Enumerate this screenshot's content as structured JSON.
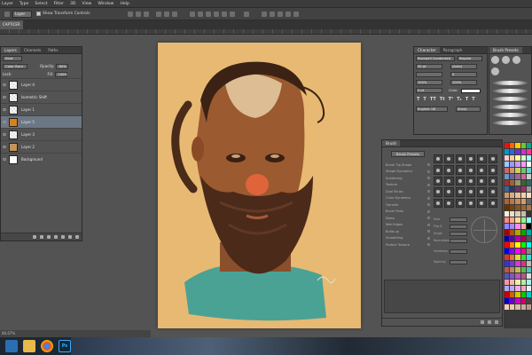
{
  "menubar": {
    "items": [
      "Layer",
      "Type",
      "Select",
      "Filter",
      "3D",
      "View",
      "Window",
      "Help"
    ]
  },
  "options": {
    "tool_preset": "Layer",
    "show_transform_label": "Show Transform Controls"
  },
  "document": {
    "tab_title": "CAPTICER"
  },
  "layers_panel": {
    "tabs": [
      "Layers",
      "Channels",
      "Paths"
    ],
    "kind_filter": "Kind",
    "blend_mode": "Color Burn",
    "opacity_label": "Opacity:",
    "opacity_value": "80%",
    "lock_label": "Lock:",
    "fill_label": "Fill:",
    "fill_value": "100%",
    "layers": [
      {
        "name": "Layer 4",
        "selected": false,
        "thumb": "transparent"
      },
      {
        "name": "Isometric Shift",
        "selected": false,
        "thumb": "transparent"
      },
      {
        "name": "Layer 1",
        "selected": false,
        "thumb": "transparent"
      },
      {
        "name": "Layer 5",
        "selected": true,
        "thumb": "#d8821e"
      },
      {
        "name": "Layer 3",
        "selected": false,
        "thumb": "transparent"
      },
      {
        "name": "Layer 2",
        "selected": false,
        "thumb": "#c4945a"
      },
      {
        "name": "Background",
        "selected": false,
        "thumb": "#ffffff"
      }
    ]
  },
  "character_panel": {
    "tabs": [
      "Character",
      "Paragraph"
    ],
    "font_family": "Rockwell Condensed",
    "font_style": "Regular",
    "size": "30 pt",
    "leading": "(Auto)",
    "tracking": "0",
    "vertical_scale": "100%",
    "horizontal_scale": "100%",
    "baseline": "0 pt",
    "color_label": "Color:",
    "language": "English: UK",
    "antialias": "Sharp",
    "type_buttons": [
      "T",
      "T",
      "TT",
      "Tt",
      "T¹",
      "T₁",
      "T",
      "T"
    ]
  },
  "brush_presets_panel": {
    "title": "Brush Presets"
  },
  "brush_panel": {
    "title": "Brush",
    "presets_button": "Brush Presets",
    "options": [
      "Brush Tip Shape",
      "Shape Dynamics",
      "Scattering",
      "Texture",
      "Dual Brush",
      "Color Dynamics",
      "Transfer",
      "Brush Pose",
      "Noise",
      "Wet Edges",
      "Build-up",
      "Smoothing",
      "Protect Texture"
    ],
    "sliders": [
      "Size",
      "Flip X",
      "Angle",
      "Roundness",
      "Hardness",
      "Spacing"
    ]
  },
  "swatch_colors": [
    "#e11",
    "#f60",
    "#fc0",
    "#6c3",
    "#0a8",
    "#09c",
    "#36c",
    "#63c",
    "#c3c",
    "#f39",
    "#fcc",
    "#fc9",
    "#ff9",
    "#cfc",
    "#9ff",
    "#9cf",
    "#99f",
    "#c9f",
    "#f9f",
    "#fff",
    "#c66",
    "#c96",
    "#cc6",
    "#6c6",
    "#6cc",
    "#69c",
    "#669",
    "#969",
    "#c69",
    "#ccc",
    "#933",
    "#963",
    "#996",
    "#363",
    "#366",
    "#369",
    "#336",
    "#636",
    "#936",
    "#999",
    "#c96",
    "#da8",
    "#eb9",
    "#fca",
    "#fdb",
    "#a63",
    "#b74",
    "#c85",
    "#d96",
    "#666",
    "#630",
    "#741",
    "#852",
    "#963",
    "#a74",
    "#fed",
    "#edc",
    "#dcb",
    "#cba",
    "#333",
    "#f88",
    "#fa8",
    "#fd8",
    "#8f8",
    "#8ff",
    "#88f",
    "#a8f",
    "#f8f",
    "#faa",
    "#000",
    "#a00",
    "#a50",
    "#aa0",
    "#0a0",
    "#0aa",
    "#00a",
    "#50a",
    "#a0a",
    "#a05",
    "#555",
    "#f00",
    "#f80",
    "#ff0",
    "#0f0",
    "#0ff",
    "#00f",
    "#80f",
    "#f0f",
    "#f08",
    "#888",
    "#d33",
    "#d73",
    "#dd3",
    "#3d3",
    "#3dd",
    "#33d",
    "#73d",
    "#d3d",
    "#d37",
    "#bbb",
    "#b55",
    "#b85",
    "#bb5",
    "#5b5",
    "#5bb",
    "#55b",
    "#85b",
    "#b5b",
    "#b58",
    "#ddd",
    "#e9a",
    "#eba",
    "#eea",
    "#aea",
    "#aee",
    "#aae",
    "#bae",
    "#eae",
    "#eab",
    "#eee",
    "#c00",
    "#c60",
    "#cc0",
    "#0c0",
    "#0cc",
    "#00c",
    "#60c",
    "#c0c",
    "#c06",
    "#444",
    "#fcb",
    "#eca",
    "#dba",
    "#ca9",
    "#b98"
  ],
  "status": {
    "zoom": "66.67%"
  },
  "taskbar": {
    "ps_label": "Ps"
  }
}
